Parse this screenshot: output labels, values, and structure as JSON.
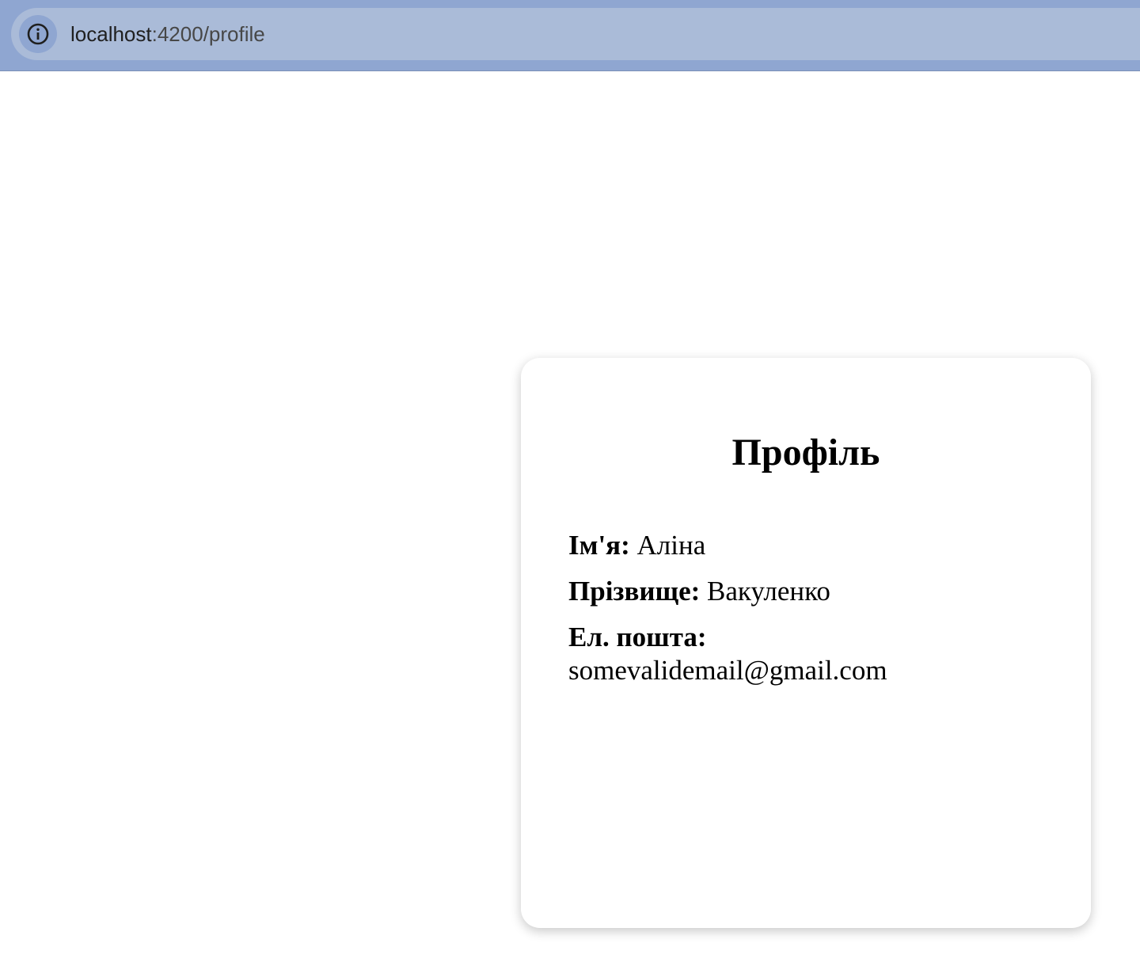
{
  "browser": {
    "url_host": "localhost",
    "url_path": ":4200/profile"
  },
  "profile": {
    "title": "Профіль",
    "fields": [
      {
        "label": "Ім'я:",
        "value": "Аліна"
      },
      {
        "label": "Прізвище:",
        "value": "Вакуленко"
      },
      {
        "label": "Ел. пошта:",
        "value": "somevalidemail@gmail.com"
      }
    ]
  }
}
